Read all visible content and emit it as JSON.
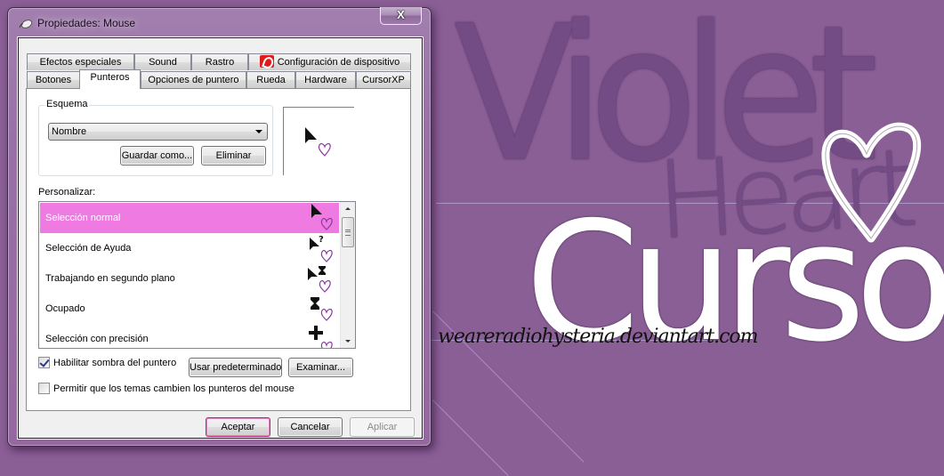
{
  "window": {
    "title": "Propiedades: Mouse",
    "close_label": "X"
  },
  "tabs": {
    "row1": [
      {
        "label": "Efectos especiales"
      },
      {
        "label": "Sound"
      },
      {
        "label": "Rastro"
      },
      {
        "label": "Configuración de dispositivo",
        "icon": "device-settings-icon"
      }
    ],
    "row2": [
      {
        "label": "Botones"
      },
      {
        "label": "Punteros",
        "active": true
      },
      {
        "label": "Opciones de puntero"
      },
      {
        "label": "Rueda"
      },
      {
        "label": "Hardware"
      },
      {
        "label": "CursorXP"
      }
    ]
  },
  "scheme": {
    "group_label": "Esquema",
    "selected": "Nombre",
    "save_as_label": "Guardar como...",
    "delete_label": "Eliminar"
  },
  "customize": {
    "label": "Personalizar:",
    "items": [
      {
        "label": "Selección normal",
        "cursor": "arrow-heart",
        "selected": true
      },
      {
        "label": "Selección de Ayuda",
        "cursor": "help-arrow-heart"
      },
      {
        "label": "Trabajando en segundo plano",
        "cursor": "working-arrow-heart"
      },
      {
        "label": "Ocupado",
        "cursor": "hourglass-heart"
      },
      {
        "label": "Selección con precisión",
        "cursor": "crosshair-heart"
      }
    ]
  },
  "options": {
    "shadow_label": "Habilitar sombra del puntero",
    "shadow_checked": true,
    "themes_label": "Permitir que los temas cambien los punteros del mouse",
    "themes_checked": false,
    "use_default_label": "Usar predeterminado",
    "browse_label": "Examinar..."
  },
  "footer": {
    "ok_label": "Aceptar",
    "cancel_label": "Cancelar",
    "apply_label": "Aplicar"
  },
  "artwork": {
    "word1": "Violet",
    "word2": "Heart",
    "word3": "Cursor",
    "url": "weareradiohysteria.deviantart.com"
  },
  "colors": {
    "background": "#8a5f96",
    "selection": "#ee7ae2",
    "heart_outline": "#8b3aa0",
    "default_button_border": "#c0247a"
  }
}
